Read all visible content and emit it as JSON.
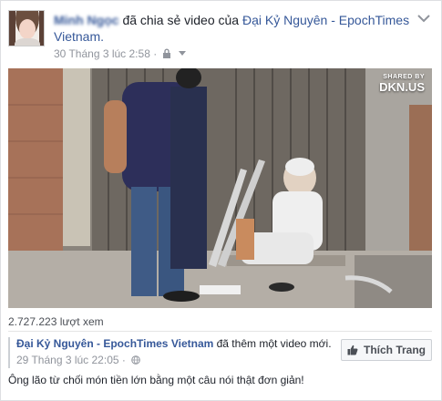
{
  "post": {
    "author_name": "Minh Ngọc",
    "action_text": "đã chia sẻ video của",
    "shared_page": "Đại Kỷ Nguyên - EpochTimes Vietnam.",
    "timestamp": "30 Tháng 3 lúc 2:58 ·",
    "privacy_icon": "lock-icon",
    "audience_caret_icon": "chevron-down-icon"
  },
  "video": {
    "watermark_small": "SHARED BY",
    "watermark_big": "DKN.US",
    "views": "2.727.223 lượt xem"
  },
  "shared_post": {
    "page_name": "Đại Kỷ Nguyên - EpochTimes Vietnam",
    "action_text": "đã thêm một video mới.",
    "timestamp": "29 Tháng 3 lúc 22:05 ·",
    "like_button": "Thích Trang",
    "caption": "Ông lão từ chối món tiền lớn bằng một câu nói thật đơn giản!"
  },
  "colors": {
    "link": "#365899",
    "meta": "#90949c"
  }
}
